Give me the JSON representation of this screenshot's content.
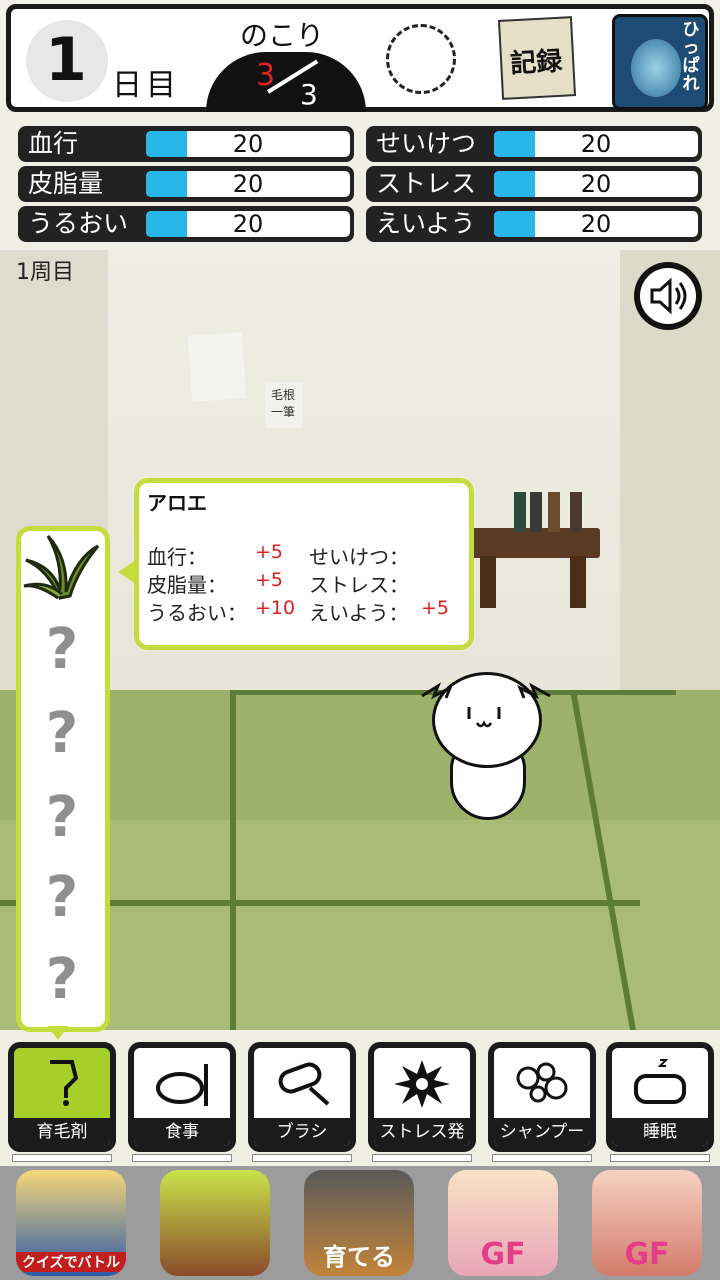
{
  "header": {
    "day_number": "1",
    "day_label": "日目",
    "remaining_label": "のこり",
    "remaining_current": "3",
    "remaining_total": "3",
    "record_label": "記録",
    "pull_label": "ひっぱれ"
  },
  "stats": [
    {
      "label": "血行",
      "value": "20",
      "level": 0.2
    },
    {
      "label": "皮脂量",
      "value": "20",
      "level": 0.2
    },
    {
      "label": "うるおい",
      "value": "20",
      "level": 0.2
    },
    {
      "label": "せいけつ",
      "value": "20",
      "level": 0.2
    },
    {
      "label": "ストレス",
      "value": "20",
      "level": 0.2
    },
    {
      "label": "えいよう",
      "value": "20",
      "level": 0.2
    }
  ],
  "lap_label": "1周目",
  "tooltip": {
    "title": "アロエ",
    "rows": [
      {
        "label": "血行：",
        "value": "+5",
        "label2": "せいけつ：",
        "value2": ""
      },
      {
        "label": "皮脂量：",
        "value": "+5",
        "label2": "ストレス：",
        "value2": ""
      },
      {
        "label": "うるおい：",
        "value": "+10",
        "label2": "えいよう：",
        "value2": "+5"
      }
    ]
  },
  "items": {
    "unknown_glyph": "?"
  },
  "background": {
    "paper_text": "毛根一筆"
  },
  "actions": [
    {
      "label": "育毛剤",
      "icon": "bottle-icon",
      "active": true
    },
    {
      "label": "食事",
      "icon": "plate-icon",
      "active": false
    },
    {
      "label": "ブラシ",
      "icon": "brush-icon",
      "active": false
    },
    {
      "label": "ストレス発散",
      "icon": "burst-icon",
      "active": false
    },
    {
      "label": "シャンプー",
      "icon": "bubbles-icon",
      "active": false
    },
    {
      "label": "睡眠",
      "icon": "pillow-icon",
      "active": false
    }
  ],
  "ads": [
    {
      "label": "クイズでバトル"
    },
    {
      "label": ""
    },
    {
      "label": "育てる"
    },
    {
      "label": "GF"
    },
    {
      "label": "GF"
    }
  ]
}
